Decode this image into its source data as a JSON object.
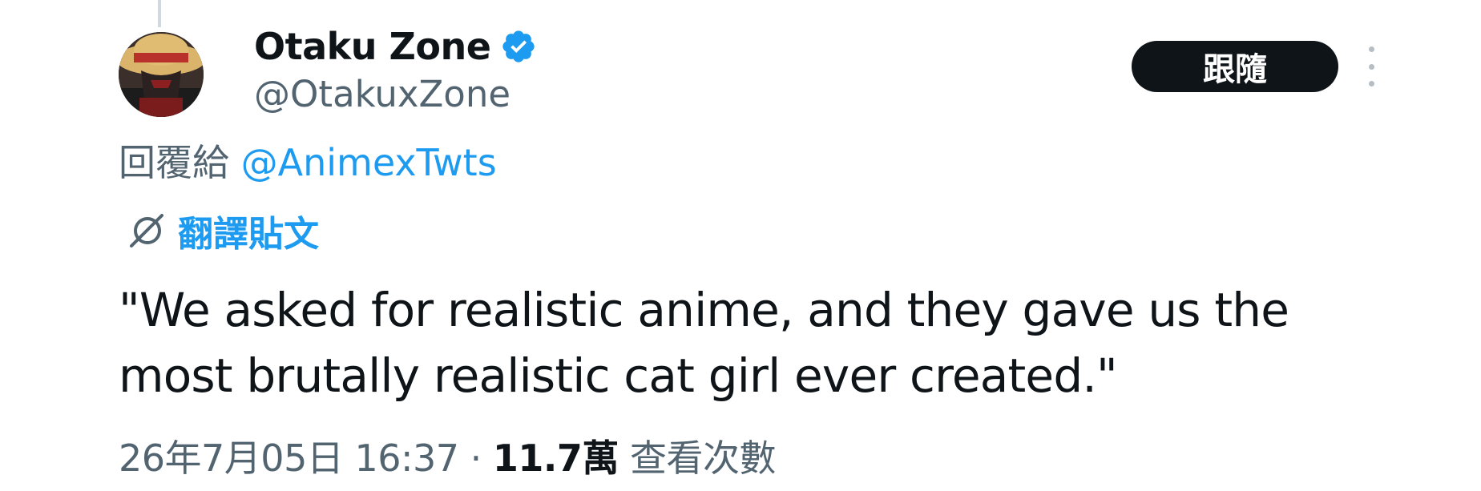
{
  "author": {
    "display_name": "Otaku Zone",
    "handle": "@OtakuxZone",
    "verified": true,
    "avatar": "avatar-straw-hat-character",
    "verified_icon": "verified-badge-icon"
  },
  "actions": {
    "follow_label": "跟隨",
    "more_icon": "more-vertical-icon"
  },
  "reply": {
    "prefix": "回覆給",
    "handle": "@AnimexTwts"
  },
  "translate": {
    "icon": "translate-icon",
    "label": "翻譯貼文"
  },
  "tweet": {
    "text_lines": [
      "\"We asked for realistic anime, and they gave us the",
      "most brutally realistic cat girl ever created.\""
    ]
  },
  "meta": {
    "timestamp": "26年7月05日 16:37",
    "separator": " · ",
    "views_count": "11.7萬",
    "views_label": " 查看次數"
  },
  "colors": {
    "text_primary": "#0f1419",
    "text_secondary": "#536471",
    "link": "#1d9bf0",
    "follow_bg": "#0f1419",
    "thread_line": "#cfd9de"
  }
}
